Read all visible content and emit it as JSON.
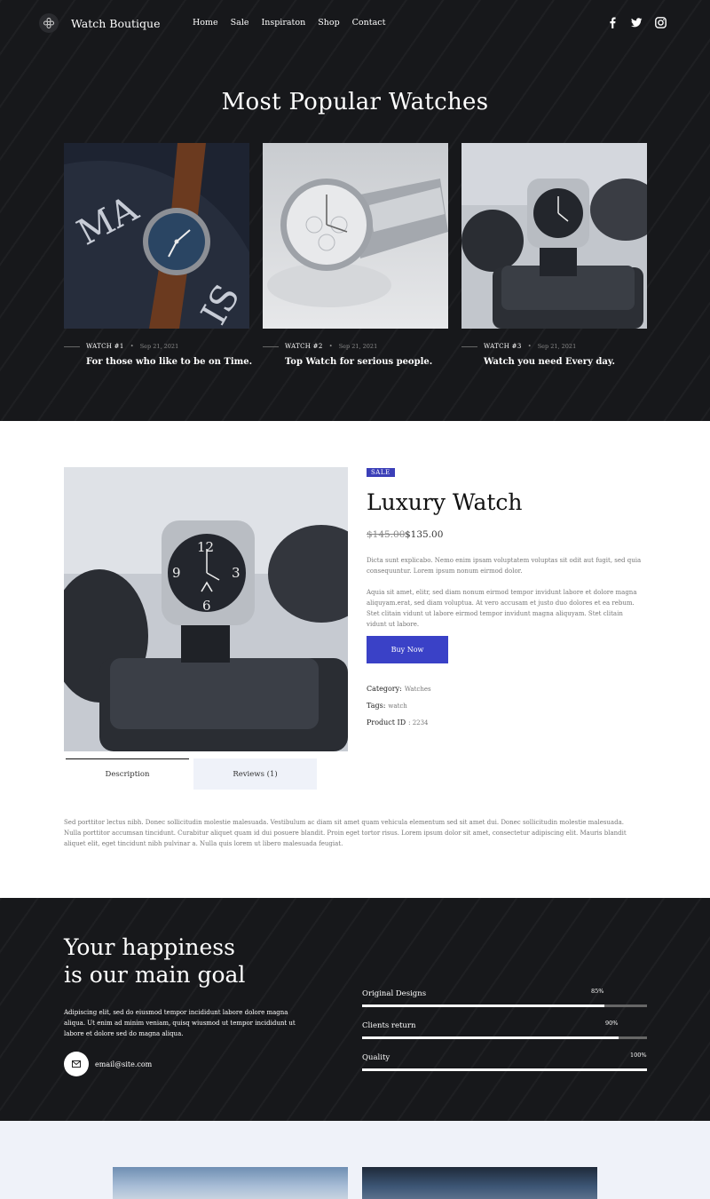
{
  "header": {
    "logo_text": "Watch Boutique",
    "nav": [
      "Home",
      "Sale",
      "Inspiraton",
      "Shop",
      "Contact"
    ],
    "social_icons": [
      "facebook-icon",
      "twitter-icon",
      "instagram-icon"
    ]
  },
  "hero": {
    "title": "Most Popular Watches",
    "cards": [
      {
        "number": "WATCH #1",
        "date": "Sep 21, 2021",
        "title": "For those who like to be on Time."
      },
      {
        "number": "WATCH #2",
        "date": "Sep 21, 2021",
        "title": "Top Watch for serious people."
      },
      {
        "number": "WATCH #3",
        "date": "Sep 21, 2021",
        "title": "Watch you need Every day."
      }
    ]
  },
  "product": {
    "badge": "SALE",
    "title": "Luxury Watch",
    "old_price": "$145.00",
    "price": "$135.00",
    "desc1": "Dicta sunt explicabo. Nemo enim ipsam voluptatem voluptas sit odit aut fugit, sed quia consequuntur. Lorem ipsum nonum eirmod dolor.",
    "desc2": "Aquia sit amet, elitr, sed diam nonum eirmod tempor invidunt labore et dolore magna aliquyam.erat, sed diam voluptua. At vero accusam et justo duo dolores et ea rebum. Stet clitain vidunt ut labore eirmod tempor invidunt magna aliquyam. Stet clitain vidunt ut labore.",
    "buy_label": "Buy Now",
    "category_label": "Category:",
    "category_value": "Watches",
    "tags_label": "Tags:",
    "tags_value": "watch",
    "pid_label": "Product ID",
    "pid_value": ": 2234",
    "tabs": [
      "Description",
      "Reviews (1)"
    ],
    "tab_text": "Sed porttitor lectus nibh. Donec sollicitudin molestie malesuada. Vestibulum ac diam sit amet quam vehicula elementum sed sit amet dui. Donec sollicitudin molestie malesuada. Nulla porttitor accumsan tincidunt. Curabitur aliquet quam id dui posuere blandit. Proin eget tortor risus. Lorem ipsum dolor sit amet, consectetur adipiscing elit. Mauris blandit aliquet elit, eget tincidunt nibh pulvinar a. Nulla quis lorem ut libero malesuada feugiat."
  },
  "happiness": {
    "title_line1": "Your happiness",
    "title_line2": "is our main goal",
    "text": "Adipiscing elit, sed do eiusmod tempor incididunt labore dolore magna aliqua. Ut enim ad minim veniam, quisq wiusmod ut tempor incididunt ut labore et dolore sed do magna aliqua.",
    "email": "email@site.com",
    "skills": [
      {
        "label": "Original Designs",
        "percent_text": "85%",
        "value": 0.85
      },
      {
        "label": "Clients return",
        "percent_text": "90%",
        "value": 0.9
      },
      {
        "label": "Quality",
        "percent_text": "100%",
        "value": 1.0
      }
    ]
  },
  "colors": {
    "dark_bg": "#17181b",
    "accent": "#3a41c7",
    "badge": "#3b3fb8",
    "light_bg": "#eff2f9"
  }
}
